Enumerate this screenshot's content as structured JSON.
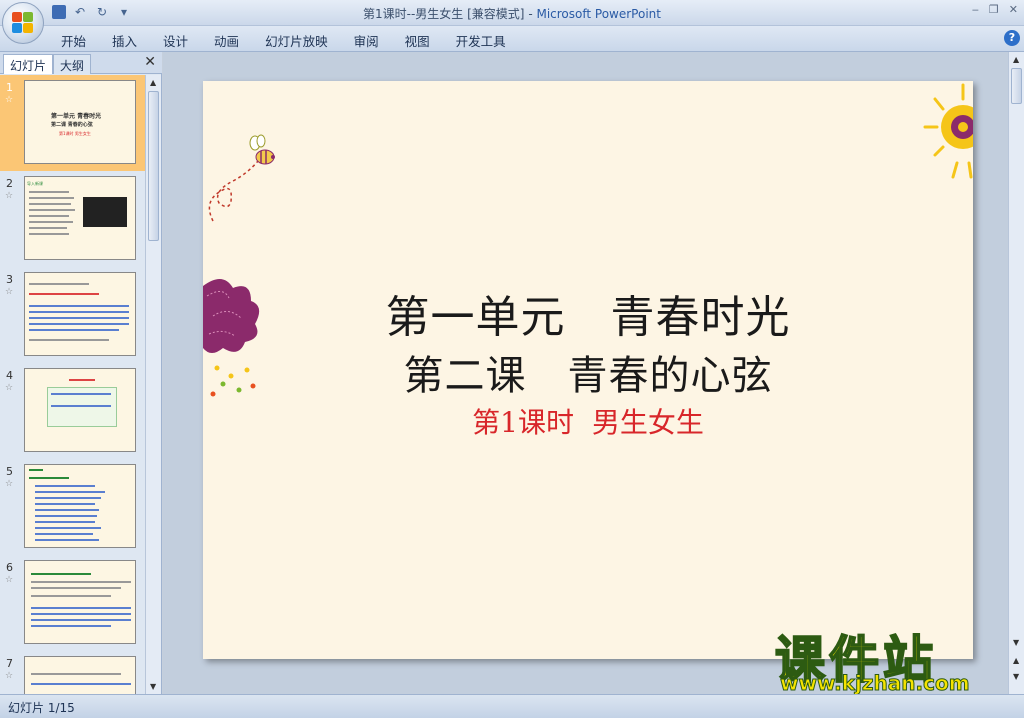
{
  "window": {
    "title": "第1课时--男生女生 [兼容模式]",
    "app_name": "Microsoft PowerPoint",
    "separator": " - "
  },
  "menu": {
    "items": [
      "开始",
      "插入",
      "设计",
      "动画",
      "幻灯片放映",
      "审阅",
      "视图",
      "开发工具"
    ]
  },
  "panel": {
    "tabs": [
      "幻灯片",
      "大纲"
    ],
    "close_icon": "close-icon"
  },
  "thumbnails": [
    {
      "number": "1",
      "lines": [
        "第一单元  青春时光",
        "第二课  青春的心弦",
        "第1课时  男生女生"
      ]
    },
    {
      "number": "2",
      "lines": [
        "导入新课"
      ]
    },
    {
      "number": "3",
      "lines": []
    },
    {
      "number": "4",
      "lines": []
    },
    {
      "number": "5",
      "lines": []
    },
    {
      "number": "6",
      "lines": []
    },
    {
      "number": "7",
      "lines": []
    }
  ],
  "slide": {
    "title_line1": "第一单元　青春时光",
    "title_line2": "第二课　青春的心弦",
    "subtitle_num": "第1课时",
    "subtitle_rest": "男生女生",
    "colors": {
      "background": "#fdf5e4",
      "subtitle": "#d8262a",
      "accent_purple": "#8b2a6b",
      "accent_yellow": "#f5c518"
    }
  },
  "watermark": {
    "logo_text": "课件站",
    "url": "www.kjzhan.com"
  },
  "status": {
    "slide_indicator": "幻灯片 1/15"
  }
}
